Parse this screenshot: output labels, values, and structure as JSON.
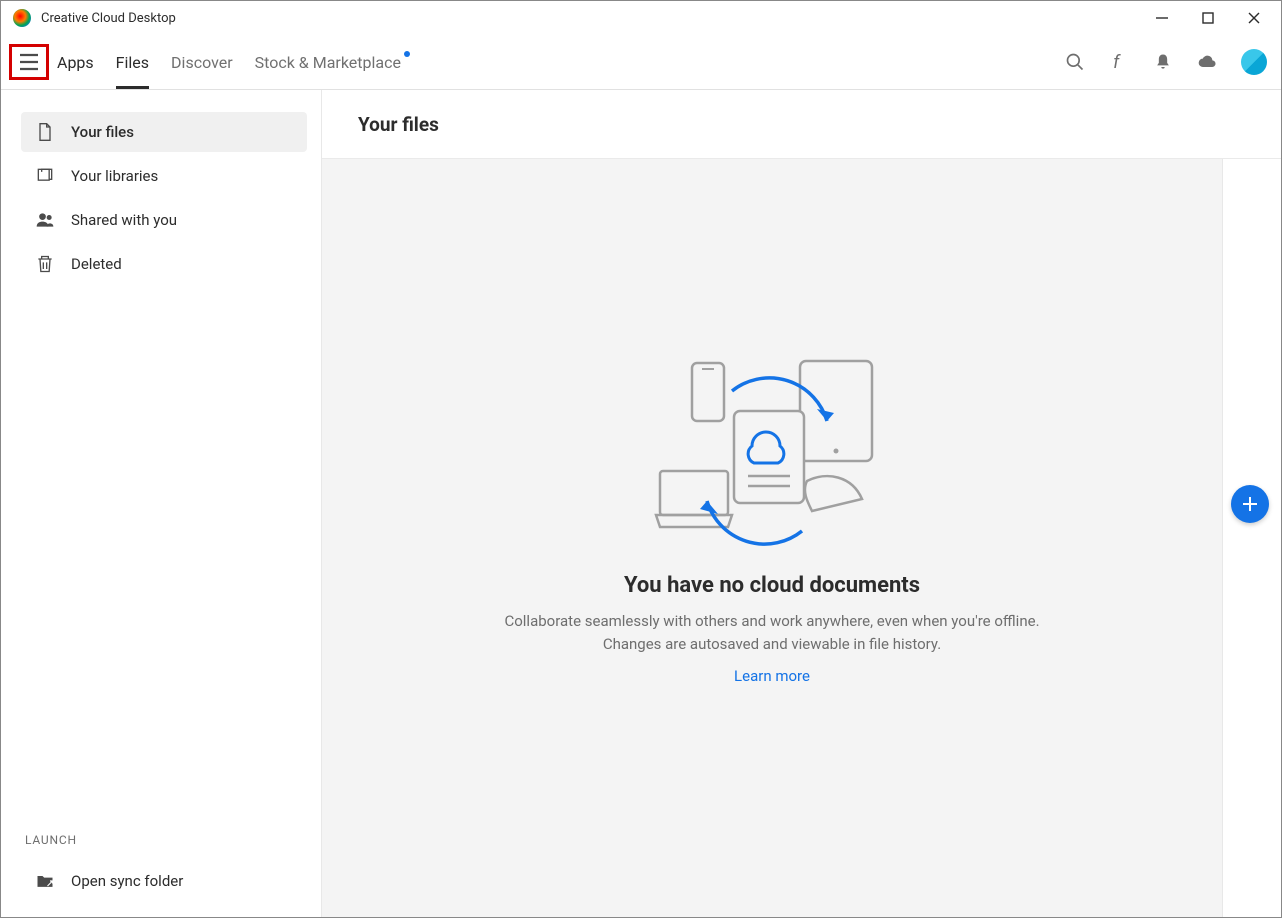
{
  "window": {
    "title": "Creative Cloud Desktop"
  },
  "header": {
    "tabs": [
      {
        "label": "Apps"
      },
      {
        "label": "Files"
      },
      {
        "label": "Discover"
      },
      {
        "label": "Stock & Marketplace",
        "hasDot": true
      }
    ],
    "activeTab": "Files"
  },
  "sidebar": {
    "items": [
      {
        "label": "Your files",
        "icon": "file"
      },
      {
        "label": "Your libraries",
        "icon": "libraries"
      },
      {
        "label": "Shared with you",
        "icon": "people"
      },
      {
        "label": "Deleted",
        "icon": "trash"
      }
    ],
    "launch": {
      "heading": "LAUNCH",
      "items": [
        {
          "label": "Open sync folder",
          "icon": "folder-sync"
        }
      ]
    }
  },
  "main": {
    "title": "Your files",
    "empty": {
      "heading": "You have no cloud documents",
      "description": "Collaborate seamlessly with others and work anywhere, even when you're offline. Changes are autosaved and viewable in file history.",
      "link": "Learn more"
    }
  },
  "colors": {
    "accent": "#1473e6"
  }
}
